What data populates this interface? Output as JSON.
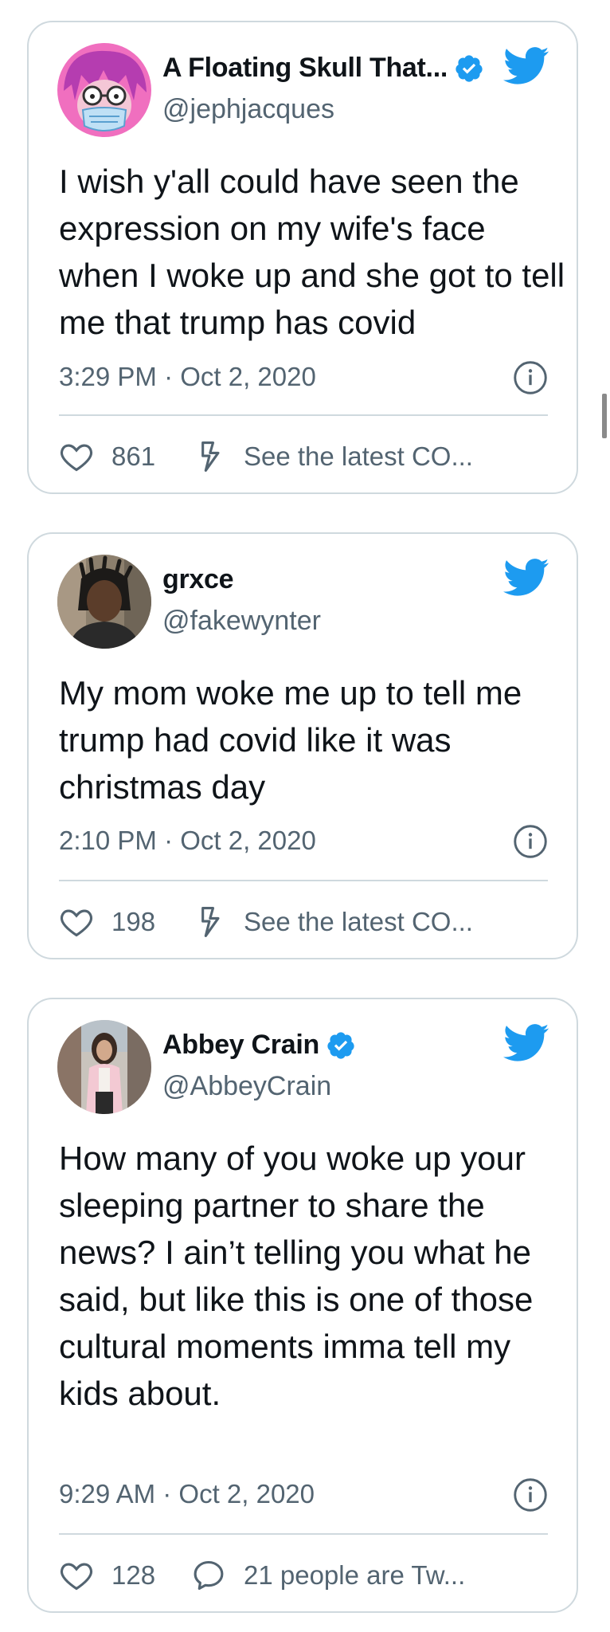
{
  "tweets": [
    {
      "name": "A Floating Skull That...",
      "verified": true,
      "handle": "@jephjacques",
      "text": "I wish y'all could have seen the expression on my wife's face when I woke up and she got to tell me that trump has covid",
      "timestamp": "3:29 PM · Oct 2, 2020",
      "likes": "861",
      "secondary_icon": "flash-icon",
      "secondary_label": "See the latest CO..."
    },
    {
      "name": "grxce",
      "verified": false,
      "handle": "@fakewynter",
      "text": "My mom woke me up to tell me trump had covid like it was christmas day",
      "timestamp": "2:10 PM · Oct 2, 2020",
      "likes": "198",
      "secondary_icon": "flash-icon",
      "secondary_label": "See the latest CO..."
    },
    {
      "name": "Abbey Crain",
      "verified": true,
      "handle": "@AbbeyCrain",
      "text": "How many of you woke up your sleeping partner to share the news? I ain’t telling you what he said, but like this is one of those cultural moments imma tell my kids about.",
      "timestamp": "9:29 AM · Oct 2, 2020",
      "likes": "128",
      "secondary_icon": "reply-bubble-icon",
      "secondary_label": "21 people are Tw..."
    }
  ],
  "colors": {
    "twitter_blue": "#1d9bf0",
    "secondary_text": "#536471",
    "border": "#cfd9de",
    "primary_text": "#0f1419"
  }
}
